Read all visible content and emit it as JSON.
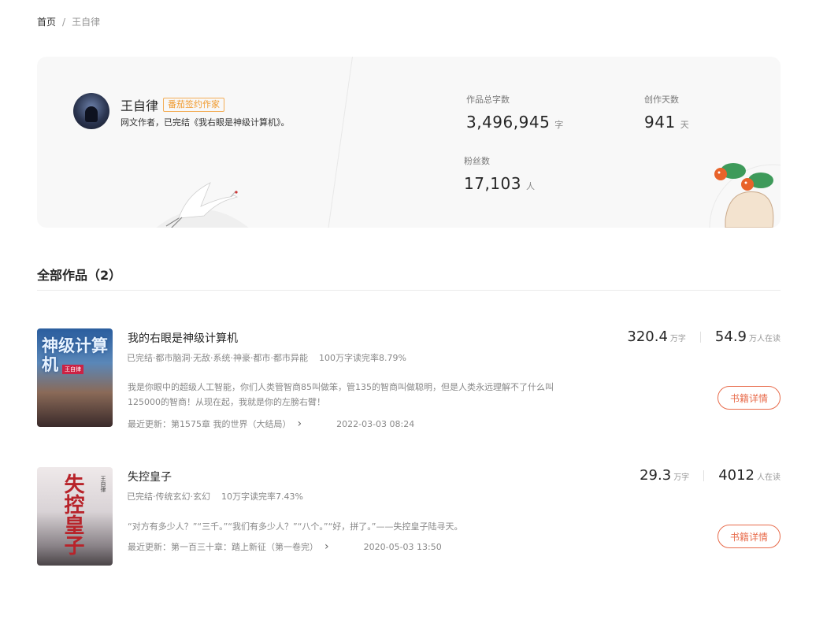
{
  "breadcrumb": {
    "home": "首页",
    "separator": "/",
    "current": "王自律"
  },
  "author": {
    "name": "王自律",
    "badge": "番茄签约作家",
    "description": "网文作者，已完结《我右眼是神级计算机》。",
    "stats": {
      "total_words": {
        "label": "作品总字数",
        "value": "3,496,945",
        "unit": "字"
      },
      "days": {
        "label": "创作天数",
        "value": "941",
        "unit": "天"
      },
      "fans": {
        "label": "粉丝数",
        "value": "17,103",
        "unit": "人"
      }
    }
  },
  "section": {
    "title": "全部作品（2）"
  },
  "books": [
    {
      "title": "我的右眼是神级计算机",
      "cover_title": "神级计算机",
      "cover_author": "王自律",
      "tags": "已完结·都市脑洞·无敌·系统·神豪·都市·都市异能",
      "read_rate": "100万字读完率8.79%",
      "intro": "我是你眼中的超级人工智能，你们人类管智商85叫做笨，管135的智商叫做聪明，但是人类永远理解不了什么叫125000的智商！从现在起，我就是你的左膀右臂！",
      "last_update": "最近更新：第1575章 我的世界（大结局）",
      "update_time": "2022-03-03 08:24",
      "words": "320.4",
      "words_unit": "万字",
      "readers": "54.9",
      "readers_unit": "万人在读",
      "detail_button": "书籍详情"
    },
    {
      "title": "失控皇子",
      "cover_title": "失控皇子",
      "cover_author": "王自律",
      "tags": "已完结·传统玄幻·玄幻",
      "read_rate": "10万字读完率7.43%",
      "intro": "“对方有多少人？”“三千。”“我们有多少人？”“八个。”“好，拼了。”——失控皇子陆寻天。",
      "last_update": "最近更新：第一百三十章：踏上新征（第一卷完）",
      "update_time": "2020-05-03 13:50",
      "words": "29.3",
      "words_unit": "万字",
      "readers": "4012",
      "readers_unit": "人在读",
      "detail_button": "书籍详情"
    }
  ],
  "icons": {
    "chevron": "chevron-right-icon"
  },
  "colors": {
    "accent": "#e86c4c",
    "badge": "#f09b30"
  }
}
